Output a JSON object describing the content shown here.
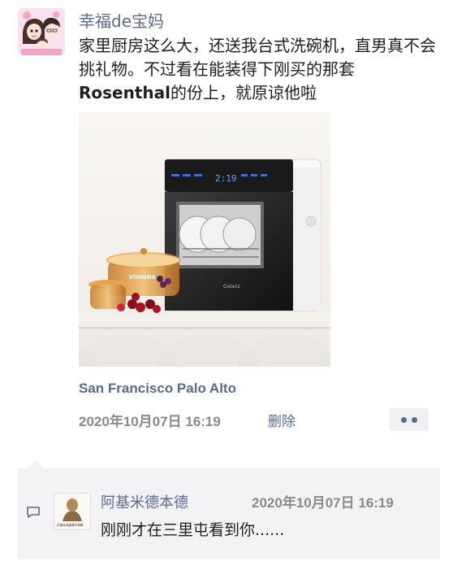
{
  "post": {
    "author": "幸福de宝妈",
    "text_prefix": "家里厨房这么大，还送我台式洗碗机，直男真不会挑礼物。不过看在能装得下刚买的那套",
    "text_brand": "Rosenthal",
    "text_suffix": "的份上，就原谅他啦",
    "image": {
      "display_time": "2:19",
      "pot_brand": "VISIONS",
      "appliance_brand": "Galanz"
    },
    "location": "San Francisco Palo Alto",
    "timestamp": "2020年10月07日 16:19",
    "delete_label": "删除"
  },
  "comment": {
    "author": "阿基米德本德",
    "timestamp": "2020年10月07日 16:19",
    "text": "刚刚才在三里屯看到你......",
    "avatar_caption": "华源兵地建源开单联"
  },
  "colors": {
    "link_blue": "#5b6a92",
    "muted_gray": "#8a8a8a",
    "comment_bg": "#f3f3f5"
  }
}
